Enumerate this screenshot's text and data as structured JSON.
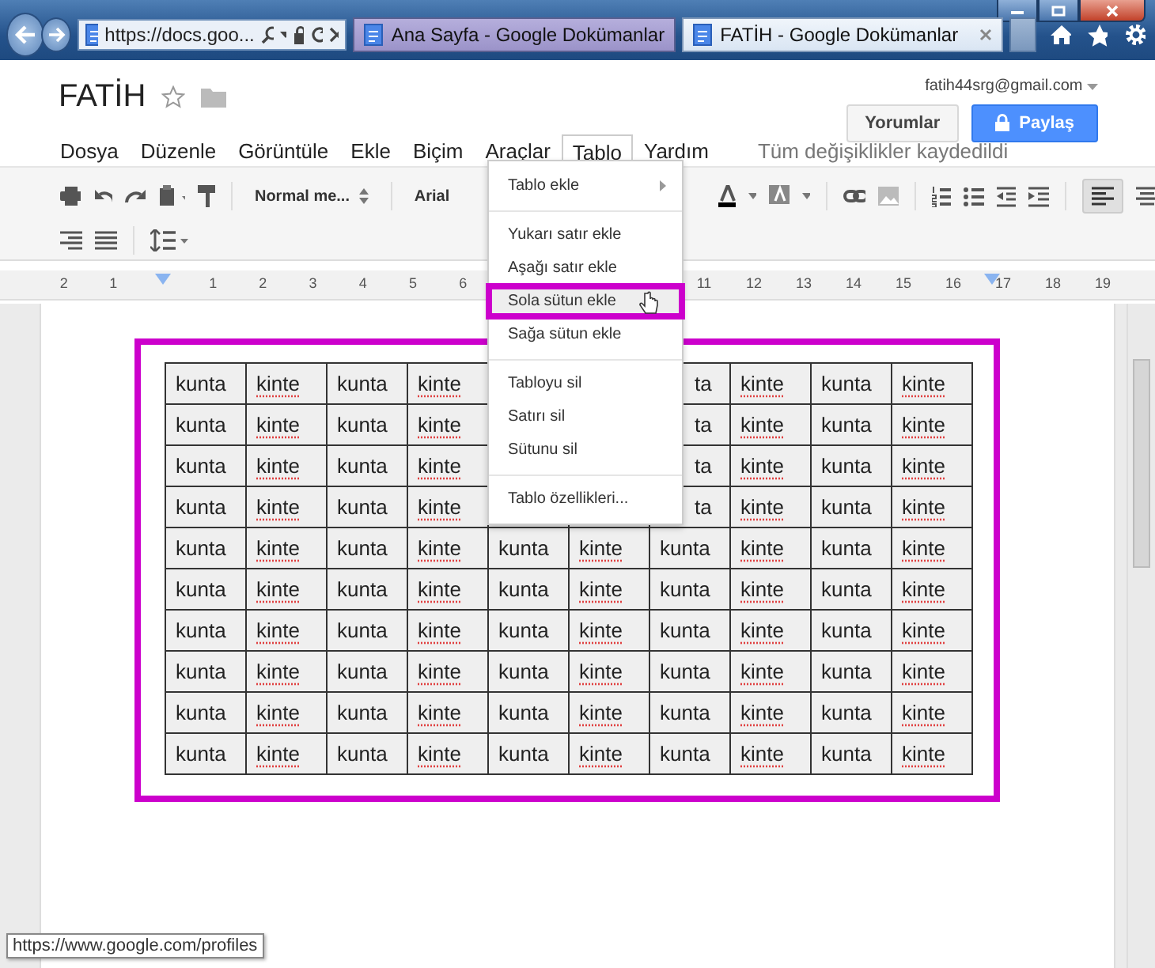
{
  "browser": {
    "address": "https://docs.goo...",
    "tabs": [
      {
        "title": "Ana Sayfa - Google Dokümanlar",
        "selected": false
      },
      {
        "title": "FATİH - Google Dokümanlar",
        "selected": true
      }
    ]
  },
  "header": {
    "title": "FATİH",
    "account": "fatih44srg@gmail.com",
    "comments_button": "Yorumlar",
    "share_button": "Paylaş"
  },
  "menus": [
    {
      "label": "Dosya",
      "selected": false
    },
    {
      "label": "Düzenle",
      "selected": false
    },
    {
      "label": "Görüntüle",
      "selected": false
    },
    {
      "label": "Ekle",
      "selected": false
    },
    {
      "label": "Biçim",
      "selected": false
    },
    {
      "label": "Araçlar",
      "selected": false
    },
    {
      "label": "Tablo",
      "selected": true
    },
    {
      "label": "Yardım",
      "selected": false
    }
  ],
  "save_status": "Tüm değişiklikler kaydedildi",
  "toolbar": {
    "style": "Normal me...",
    "font": "Arial"
  },
  "ruler": {
    "labels": [
      "2",
      "1",
      "1",
      "2",
      "3",
      "4",
      "5",
      "6",
      "11",
      "12",
      "13",
      "14",
      "15",
      "16",
      "17",
      "18",
      "19"
    ]
  },
  "dropdown": {
    "groups": [
      [
        {
          "label": "Tablo ekle",
          "submenu": true,
          "highlighted": false
        }
      ],
      [
        {
          "label": "Yukarı satır ekle",
          "submenu": false,
          "highlighted": false
        },
        {
          "label": "Aşağı satır ekle",
          "submenu": false,
          "highlighted": false
        },
        {
          "label": "Sola sütun ekle",
          "submenu": false,
          "highlighted": true
        },
        {
          "label": "Sağa sütun ekle",
          "submenu": false,
          "highlighted": false
        }
      ],
      [
        {
          "label": "Tabloyu sil",
          "submenu": false,
          "highlighted": false
        },
        {
          "label": "Satırı sil",
          "submenu": false,
          "highlighted": false
        },
        {
          "label": "Sütunu sil",
          "submenu": false,
          "highlighted": false
        }
      ],
      [
        {
          "label": "Tablo özellikleri...",
          "submenu": false,
          "highlighted": false
        }
      ]
    ]
  },
  "table": {
    "rows": [
      [
        {
          "text": "kunta",
          "misspelled": false
        },
        {
          "text": "kinte",
          "misspelled": true
        },
        {
          "text": "kunta",
          "misspelled": false
        },
        {
          "text": "kinte",
          "misspelled": true
        },
        null,
        null,
        {
          "text": "ta",
          "misspelled": false
        },
        {
          "text": "kinte",
          "misspelled": true
        },
        {
          "text": "kunta",
          "misspelled": false
        },
        {
          "text": "kinte",
          "misspelled": true
        }
      ],
      [
        {
          "text": "kunta",
          "misspelled": false
        },
        {
          "text": "kinte",
          "misspelled": true
        },
        {
          "text": "kunta",
          "misspelled": false
        },
        {
          "text": "kinte",
          "misspelled": true
        },
        null,
        null,
        {
          "text": "ta",
          "misspelled": false
        },
        {
          "text": "kinte",
          "misspelled": true
        },
        {
          "text": "kunta",
          "misspelled": false
        },
        {
          "text": "kinte",
          "misspelled": true
        }
      ],
      [
        {
          "text": "kunta",
          "misspelled": false
        },
        {
          "text": "kinte",
          "misspelled": true
        },
        {
          "text": "kunta",
          "misspelled": false
        },
        {
          "text": "kinte",
          "misspelled": true
        },
        null,
        null,
        {
          "text": "ta",
          "misspelled": false
        },
        {
          "text": "kinte",
          "misspelled": true
        },
        {
          "text": "kunta",
          "misspelled": false
        },
        {
          "text": "kinte",
          "misspelled": true
        }
      ],
      [
        {
          "text": "kunta",
          "misspelled": false
        },
        {
          "text": "kinte",
          "misspelled": true
        },
        {
          "text": "kunta",
          "misspelled": false
        },
        {
          "text": "kinte",
          "misspelled": true
        },
        null,
        null,
        {
          "text": "ta",
          "misspelled": false
        },
        {
          "text": "kinte",
          "misspelled": true
        },
        {
          "text": "kunta",
          "misspelled": false
        },
        {
          "text": "kinte",
          "misspelled": true
        }
      ],
      [
        {
          "text": "kunta",
          "misspelled": false
        },
        {
          "text": "kinte",
          "misspelled": true
        },
        {
          "text": "kunta",
          "misspelled": false
        },
        {
          "text": "kinte",
          "misspelled": true
        },
        {
          "text": "kunta",
          "misspelled": false
        },
        {
          "text": "kinte",
          "misspelled": true
        },
        {
          "text": "kunta",
          "misspelled": false
        },
        {
          "text": "kinte",
          "misspelled": true
        },
        {
          "text": "kunta",
          "misspelled": false
        },
        {
          "text": "kinte",
          "misspelled": true
        }
      ],
      [
        {
          "text": "kunta",
          "misspelled": false
        },
        {
          "text": "kinte",
          "misspelled": true
        },
        {
          "text": "kunta",
          "misspelled": false
        },
        {
          "text": "kinte",
          "misspelled": true
        },
        {
          "text": "kunta",
          "misspelled": false
        },
        {
          "text": "kinte",
          "misspelled": true
        },
        {
          "text": "kunta",
          "misspelled": false
        },
        {
          "text": "kinte",
          "misspelled": true
        },
        {
          "text": "kunta",
          "misspelled": false
        },
        {
          "text": "kinte",
          "misspelled": true
        }
      ],
      [
        {
          "text": "kunta",
          "misspelled": false
        },
        {
          "text": "kinte",
          "misspelled": true
        },
        {
          "text": "kunta",
          "misspelled": false
        },
        {
          "text": "kinte",
          "misspelled": true
        },
        {
          "text": "kunta",
          "misspelled": false
        },
        {
          "text": "kinte",
          "misspelled": true
        },
        {
          "text": "kunta",
          "misspelled": false
        },
        {
          "text": "kinte",
          "misspelled": true
        },
        {
          "text": "kunta",
          "misspelled": false
        },
        {
          "text": "kinte",
          "misspelled": true
        }
      ],
      [
        {
          "text": "kunta",
          "misspelled": false
        },
        {
          "text": "kinte",
          "misspelled": true
        },
        {
          "text": "kunta",
          "misspelled": false
        },
        {
          "text": "kinte",
          "misspelled": true
        },
        {
          "text": "kunta",
          "misspelled": false
        },
        {
          "text": "kinte",
          "misspelled": true
        },
        {
          "text": "kunta",
          "misspelled": false
        },
        {
          "text": "kinte",
          "misspelled": true
        },
        {
          "text": "kunta",
          "misspelled": false
        },
        {
          "text": "kinte",
          "misspelled": true
        }
      ],
      [
        {
          "text": "kunta",
          "misspelled": false
        },
        {
          "text": "kinte",
          "misspelled": true
        },
        {
          "text": "kunta",
          "misspelled": false
        },
        {
          "text": "kinte",
          "misspelled": true
        },
        {
          "text": "kunta",
          "misspelled": false
        },
        {
          "text": "kinte",
          "misspelled": true
        },
        {
          "text": "kunta",
          "misspelled": false
        },
        {
          "text": "kinte",
          "misspelled": true
        },
        {
          "text": "kunta",
          "misspelled": false
        },
        {
          "text": "kinte",
          "misspelled": true
        }
      ],
      [
        {
          "text": "kunta",
          "misspelled": false
        },
        {
          "text": "kinte",
          "misspelled": true
        },
        {
          "text": "kunta",
          "misspelled": false
        },
        {
          "text": "kinte",
          "misspelled": true
        },
        {
          "text": "kunta",
          "misspelled": false
        },
        {
          "text": "kinte",
          "misspelled": true
        },
        {
          "text": "kunta",
          "misspelled": false
        },
        {
          "text": "kinte",
          "misspelled": true
        },
        {
          "text": "kunta",
          "misspelled": false
        },
        {
          "text": "kinte",
          "misspelled": true
        }
      ]
    ]
  },
  "status_tooltip": "https://www.google.com/profiles"
}
